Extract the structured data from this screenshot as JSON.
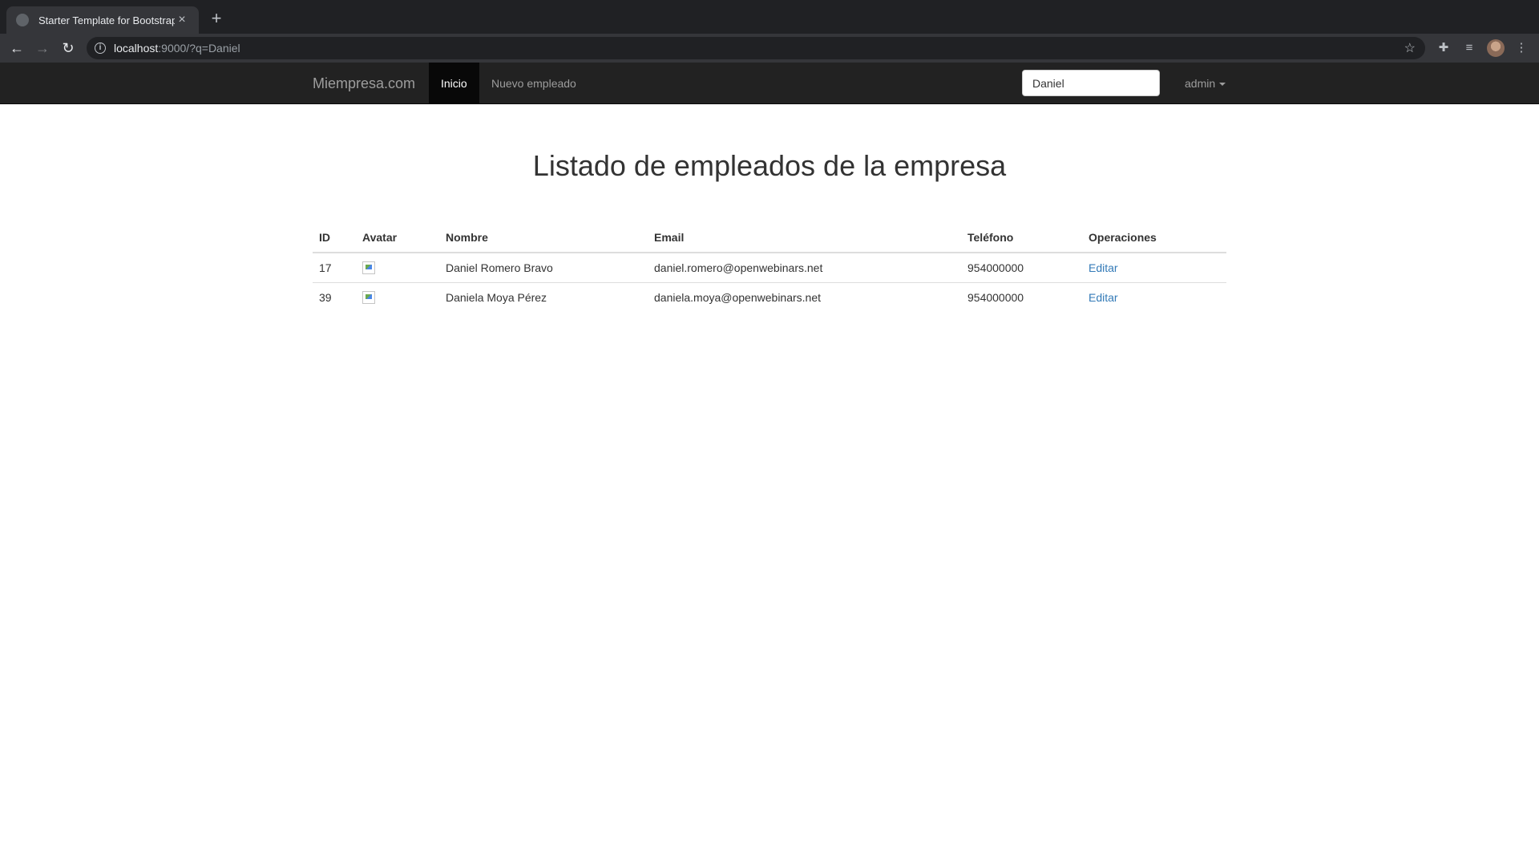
{
  "browser": {
    "tab_title": "Starter Template for Bootstrap",
    "url_host": "localhost",
    "url_rest": ":9000/?q=Daniel"
  },
  "navbar": {
    "brand": "Miempresa.com",
    "links": [
      {
        "label": "Inicio",
        "active": true
      },
      {
        "label": "Nuevo empleado",
        "active": false
      }
    ],
    "search_value": "Daniel",
    "user": "admin"
  },
  "main": {
    "title": "Listado de empleados de la empresa",
    "table": {
      "columns": [
        "ID",
        "Avatar",
        "Nombre",
        "Email",
        "Teléfono",
        "Operaciones"
      ],
      "rows": [
        {
          "id": "17",
          "nombre": "Daniel Romero Bravo",
          "email": "daniel.romero@openwebinars.net",
          "telefono": "954000000",
          "accion": "Editar"
        },
        {
          "id": "39",
          "nombre": "Daniela Moya Pérez",
          "email": "daniela.moya@openwebinars.net",
          "telefono": "954000000",
          "accion": "Editar"
        }
      ]
    }
  },
  "colors": {
    "navbar_bg": "#222222",
    "link": "#337ab7"
  },
  "icons": {
    "back": "arrow-left-icon",
    "forward": "arrow-right-icon",
    "reload": "reload-icon",
    "info": "info-icon",
    "bookmark": "star-icon",
    "extensions": "puzzle-icon",
    "media": "playlist-icon",
    "menu": "kebab-menu-icon"
  }
}
